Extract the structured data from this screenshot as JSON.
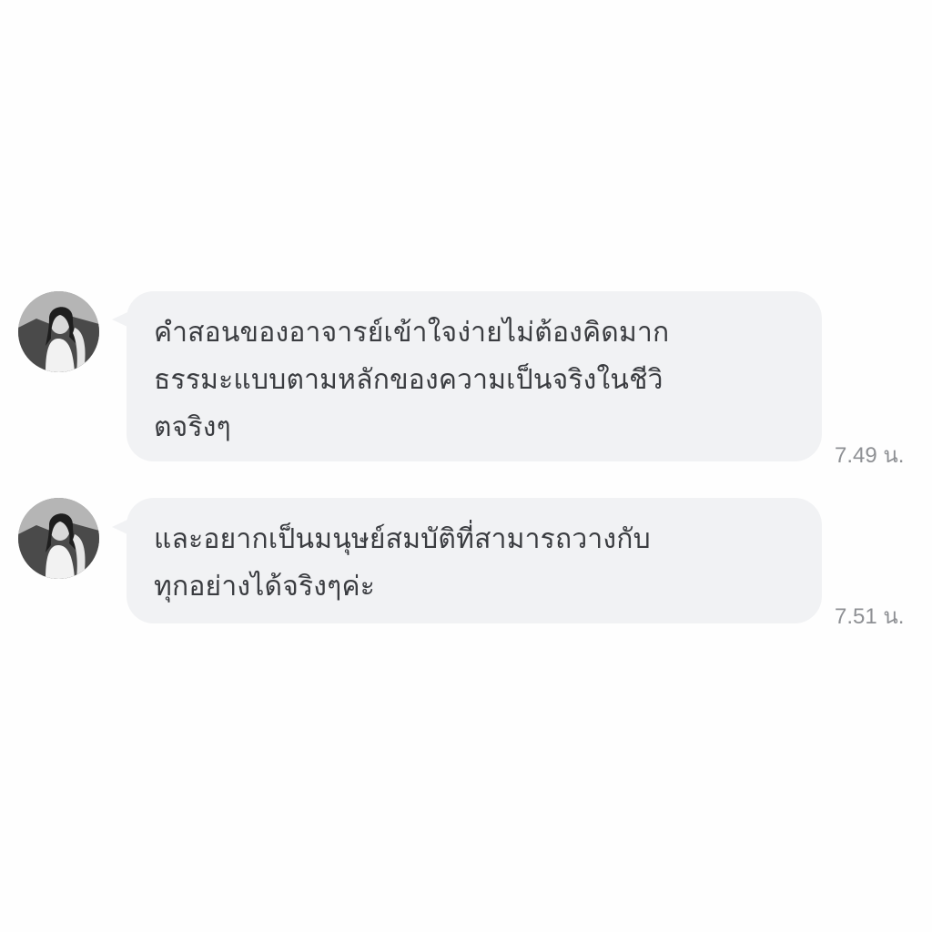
{
  "colors": {
    "page_background": "#fefefe",
    "bubble_background": "#f1f2f4",
    "message_text": "#3a3c40",
    "timestamp_text": "#8e9094"
  },
  "messages": [
    {
      "sender_avatar": "profile-photo",
      "text": "คำสอนของอาจารย์เข้าใจง่ายไม่ต้องคิดมาก\nธรรมะแบบตามหลักของความเป็นจริงในชีวิ\nตจริงๆ",
      "time": "7.49 น."
    },
    {
      "sender_avatar": "profile-photo",
      "text": "และอยากเป็นมนุษย์สมบัติที่สามารถวางกับ\nทุกอย่างได้จริงๆค่ะ",
      "time": "7.51 น."
    }
  ]
}
